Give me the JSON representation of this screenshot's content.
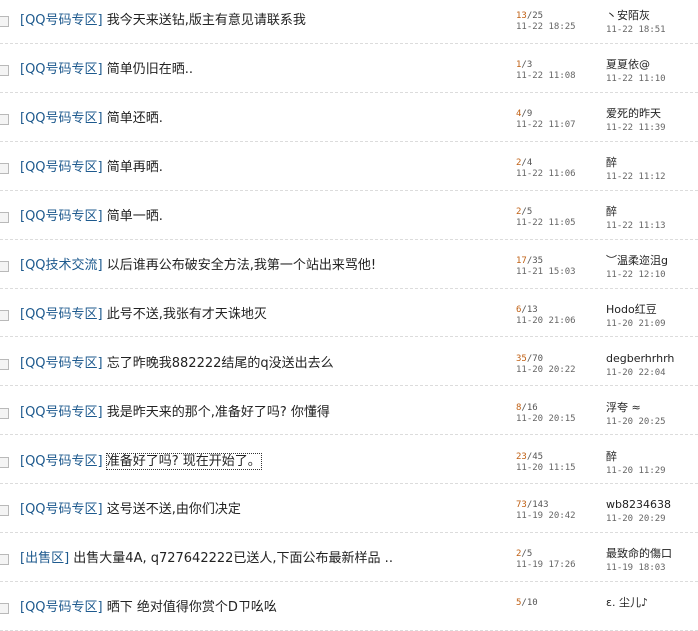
{
  "threads": [
    {
      "category": "[QQ号码专区]",
      "subject": "我今天来送钻,版主有意见请联系我",
      "replies": "13",
      "views": "25",
      "date": "11-22 18:25",
      "last_user": "丶安陌灰",
      "last_date": "11-22 18:51"
    },
    {
      "category": "[QQ号码专区]",
      "subject": "简单仍旧在晒..",
      "replies": "1",
      "views": "3",
      "date": "11-22 11:08",
      "last_user": "夏夏依@",
      "last_date": "11-22 11:10"
    },
    {
      "category": "[QQ号码专区]",
      "subject": "简单还晒.",
      "replies": "4",
      "views": "9",
      "date": "11-22 11:07",
      "last_user": "爱死的昨天",
      "last_date": "11-22 11:39"
    },
    {
      "category": "[QQ号码专区]",
      "subject": "简单再晒.",
      "replies": "2",
      "views": "4",
      "date": "11-22 11:06",
      "last_user": "醉",
      "last_date": "11-22 11:12"
    },
    {
      "category": "[QQ号码专区]",
      "subject": "简单一晒.",
      "replies": "2",
      "views": "5",
      "date": "11-22 11:05",
      "last_user": "醉",
      "last_date": "11-22 11:13"
    },
    {
      "category": "[QQ技术交流]",
      "subject": "以后谁再公布破安全方法,我第一个站出来骂他!",
      "replies": "17",
      "views": "35",
      "date": "11-21 15:03",
      "last_user": "︶温柔迩沮g",
      "last_date": "11-22 12:10"
    },
    {
      "category": "[QQ号码专区]",
      "subject": "此号不送,我张有才天诛地灭",
      "replies": "6",
      "views": "13",
      "date": "11-20 21:06",
      "last_user": "Hodo红豆",
      "last_date": "11-20 21:09"
    },
    {
      "category": "[QQ号码专区]",
      "subject": "忘了昨晚我882222结尾的q没送出去么",
      "replies": "35",
      "views": "70",
      "date": "11-20 20:22",
      "last_user": "degberhrhrh",
      "last_date": "11-20 22:04"
    },
    {
      "category": "[QQ号码专区]",
      "subject": "我是昨天来的那个,准备好了吗? 你懂得",
      "replies": "8",
      "views": "16",
      "date": "11-20 20:15",
      "last_user": "浮夸 ≈",
      "last_date": "11-20 20:25"
    },
    {
      "category": "[QQ号码专区]",
      "subject": "准备好了吗? 现在开始了。",
      "replies": "23",
      "views": "45",
      "date": "11-20 11:15",
      "last_user": "醉",
      "last_date": "11-20 11:29"
    },
    {
      "category": "[QQ号码专区]",
      "subject": "这号送不送,由你们决定",
      "replies": "73",
      "views": "143",
      "date": "11-19 20:42",
      "last_user": "wb8234638",
      "last_date": "11-20 20:29"
    },
    {
      "category": "[出售区]",
      "subject": "出售大量4A, q727642222已送人,下面公布最新样品 ..",
      "replies": "2",
      "views": "5",
      "date": "11-19 17:26",
      "last_user": "最致命的傷口",
      "last_date": "11-19 18:03"
    },
    {
      "category": "[QQ号码专区]",
      "subject": "晒下 绝对值得你赏个Dㄗ吆吆",
      "replies": "5",
      "views": "10",
      "date": "",
      "last_user": "ε.  尘儿♪",
      "last_date": ""
    }
  ]
}
